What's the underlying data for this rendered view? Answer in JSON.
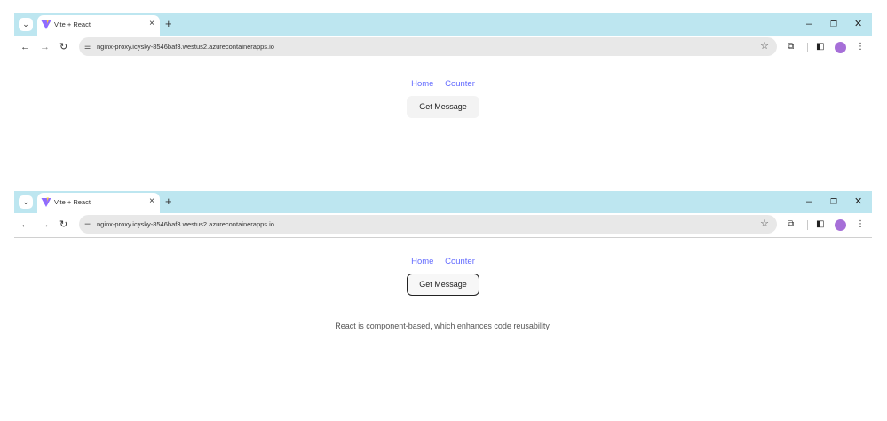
{
  "browser": {
    "tab_menu_icon": "chevron-down-icon",
    "tab_title": "Vite + React",
    "tab_close": "×",
    "new_tab": "+",
    "window_controls": {
      "minimize": "–",
      "maximize": "❐",
      "close": "✕"
    },
    "nav": {
      "back": "←",
      "forward": "→",
      "reload": "↻"
    },
    "url": "nginx-proxy.icysky-8546baf3.westus2.azurecontainerapps.io",
    "icons": {
      "site_info": "tune-icon",
      "bookmark": "star-icon",
      "extensions": "puzzle-icon",
      "side_panel": "side-panel-icon",
      "profile": "avatar-icon",
      "menu": "kebab-menu-icon"
    }
  },
  "app": {
    "nav_links": {
      "home": "Home",
      "counter": "Counter"
    },
    "button_label": "Get Message",
    "message": "React is component-based, which enhances code reusability."
  },
  "colors": {
    "tabbar": "#bde6f0",
    "link": "#646cff",
    "avatar": "#a66fd8"
  }
}
